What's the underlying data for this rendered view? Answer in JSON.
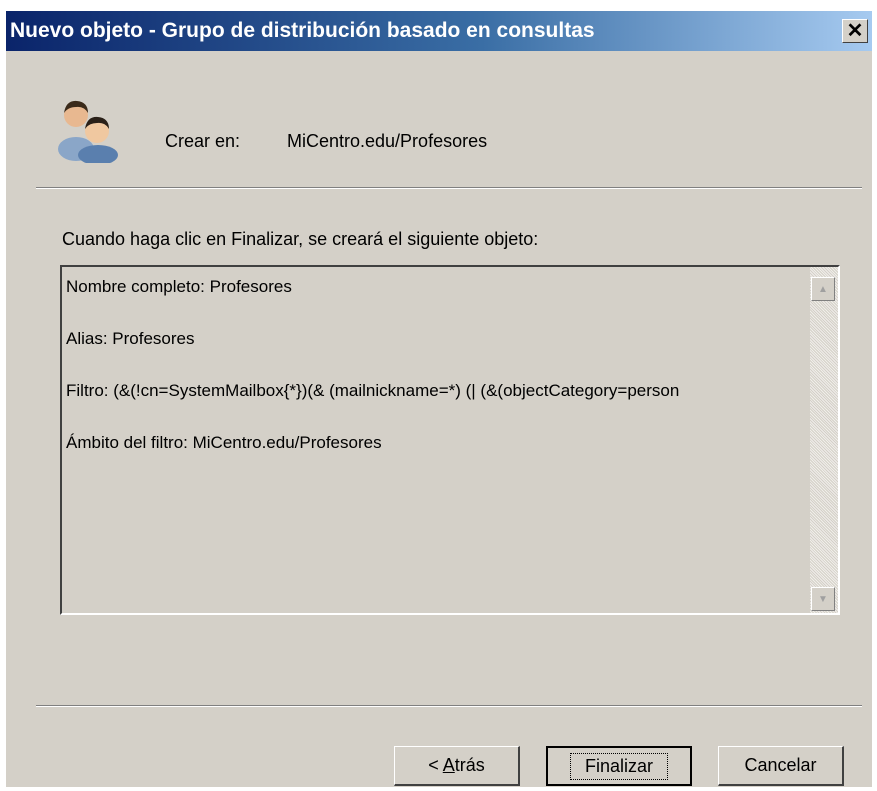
{
  "window": {
    "title": "Nuevo objeto - Grupo de distribución basado en consultas",
    "close_glyph": "✕"
  },
  "header": {
    "icon": "users-group-icon",
    "create_in_label": "Crear en:",
    "create_in_value": "MiCentro.edu/Profesores"
  },
  "body": {
    "intro_text": "Cuando haga clic en Finalizar, se creará el siguiente objeto:",
    "summary_lines": [
      "Nombre completo: Profesores",
      "Alias: Profesores",
      "Filtro: (&(!cn=SystemMailbox{*})(& (mailnickname=*) (| (&(objectCategory=person",
      "Ámbito del filtro: MiCentro.edu/Profesores"
    ]
  },
  "buttons": {
    "back_prefix": "< ",
    "back_mnemonic": "A",
    "back_rest": "trás",
    "finish_label": "Finalizar",
    "cancel_label": "Cancelar"
  },
  "colors": {
    "dialog_bg": "#d4d0c8",
    "title_start": "#0a246a",
    "title_end": "#a6caf0"
  }
}
